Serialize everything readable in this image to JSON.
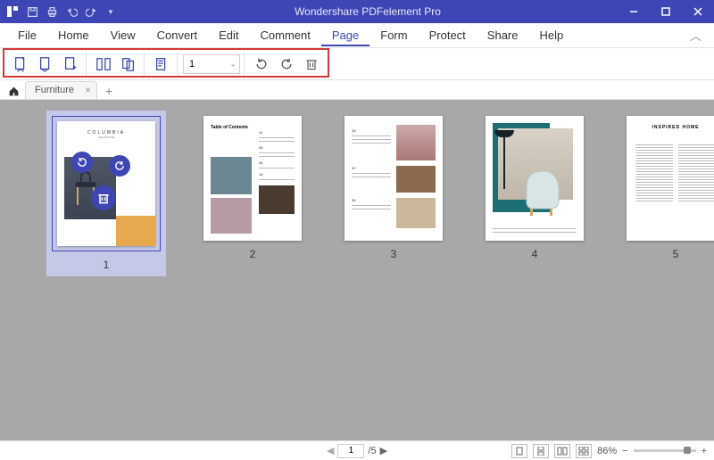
{
  "titlebar": {
    "app_title": "Wondershare PDFelement Pro"
  },
  "menu": {
    "items": [
      "File",
      "Home",
      "View",
      "Convert",
      "Edit",
      "Comment",
      "Page",
      "Form",
      "Protect",
      "Share",
      "Help"
    ],
    "active": "Page"
  },
  "toolbar": {
    "page_value": "1",
    "icons": {
      "insert_page": "insert-page",
      "extract_page": "extract-page",
      "add_page": "add-blank-page",
      "split": "split-doc",
      "merge": "merge-doc",
      "crop": "crop-page",
      "rotate_ccw": "rotate-left",
      "rotate_cw": "rotate-right",
      "delete": "delete-page"
    }
  },
  "tabs": {
    "doc_name": "Furniture"
  },
  "thumbs": {
    "selected": 1,
    "pages": [
      {
        "num": "1",
        "title": "COLUMBIA",
        "subtitle": "COLLECTIVE"
      },
      {
        "num": "2",
        "title": "Table of Contents",
        "nums": [
          "04",
          "06",
          "08",
          "18"
        ]
      },
      {
        "num": "3",
        "nums": [
          "28",
          "32",
          "35"
        ]
      },
      {
        "num": "4"
      },
      {
        "num": "5",
        "title": "INSPIRED HOME"
      }
    ]
  },
  "status": {
    "page_field": "1",
    "page_total": "/5",
    "zoom": "86%"
  }
}
